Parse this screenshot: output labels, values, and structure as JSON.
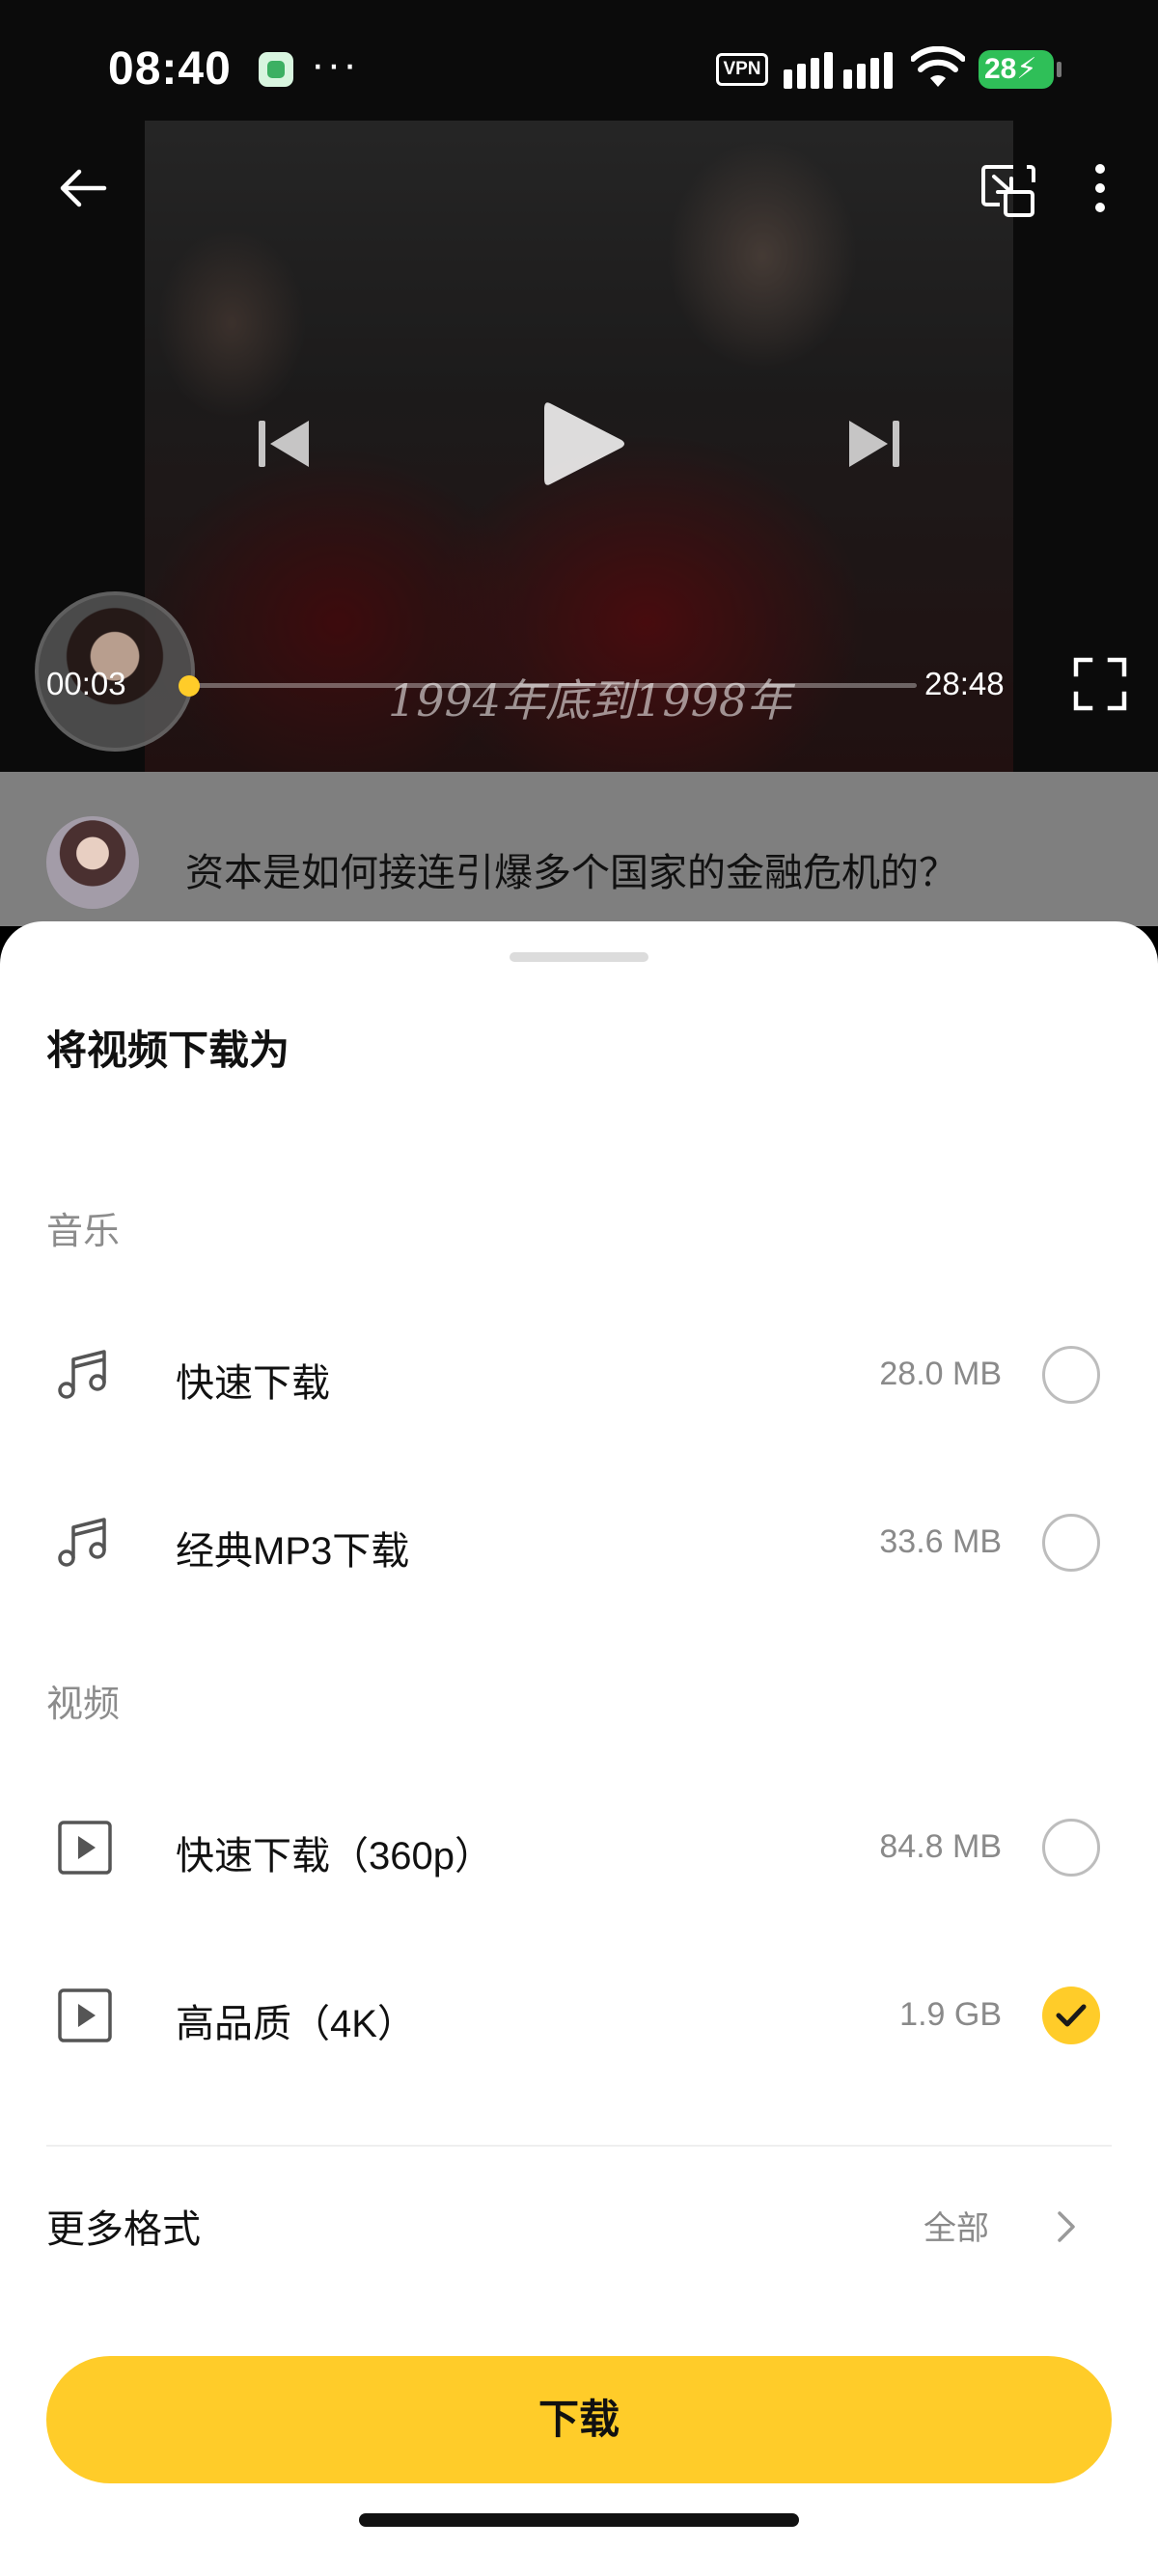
{
  "status_bar": {
    "time": "08:40",
    "more": "···",
    "vpn": "VPN",
    "battery": "28"
  },
  "player": {
    "current_time": "00:03",
    "total_time": "28:48",
    "subtitle": "1994年底到1998年",
    "progress_fraction": 0.002,
    "accent_color": "#ffcc29"
  },
  "video_info": {
    "title": "资本是如何接连引爆多个国家的金融危机的？"
  },
  "sheet": {
    "title": "将视频下载为",
    "sections": {
      "music": {
        "label": "音乐",
        "options": [
          {
            "label": "快速下载",
            "size": "28.0 MB",
            "icon": "music-note-icon",
            "selected": false
          },
          {
            "label": "经典MP3下载",
            "size": "33.6 MB",
            "icon": "music-note-icon",
            "selected": false
          }
        ]
      },
      "video": {
        "label": "视频",
        "options": [
          {
            "label": "快速下载（360p）",
            "size": "84.8 MB",
            "icon": "video-play-icon",
            "selected": false
          },
          {
            "label": "高品质（4K）",
            "size": "1.9 GB",
            "icon": "video-play-icon",
            "selected": true
          }
        ]
      }
    },
    "more_formats": {
      "label": "更多格式",
      "value": "全部"
    },
    "download_button": "下载"
  }
}
